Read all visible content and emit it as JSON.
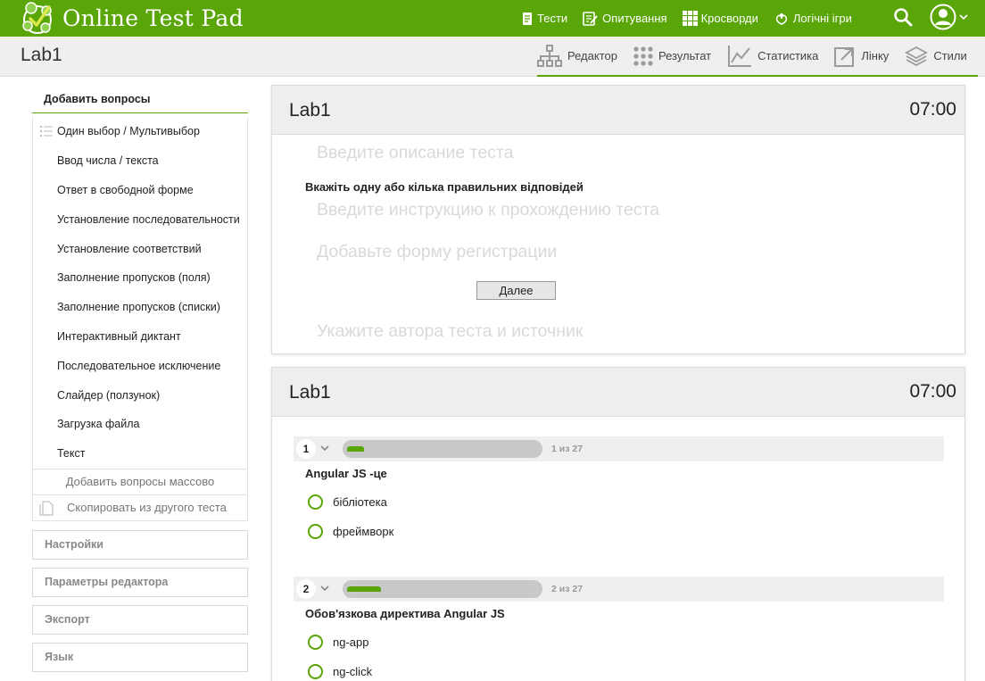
{
  "brand": {
    "name": "Online Test Pad",
    "accent": "#5aa507"
  },
  "topnav": [
    {
      "label": "Тести",
      "icon": "document-icon"
    },
    {
      "label": "Опитування",
      "icon": "survey-icon"
    },
    {
      "label": "Кросворди",
      "icon": "grid-icon"
    },
    {
      "label": "Логічні ігри",
      "icon": "puzzle-icon"
    }
  ],
  "page_title": "Lab1",
  "subnav": [
    {
      "label": "Редактор",
      "icon": "tree-icon"
    },
    {
      "label": "Результат",
      "icon": "dots-grid-icon"
    },
    {
      "label": "Статистика",
      "icon": "chart-icon"
    },
    {
      "label": "Лінку",
      "icon": "link-icon"
    },
    {
      "label": "Стили",
      "icon": "layers-icon"
    }
  ],
  "sidebar": {
    "heading": "Добавить вопросы",
    "items": [
      "Один выбор / Мультивыбор",
      "Ввод числа / текста",
      "Ответ в свободной форме",
      "Установление последовательности",
      "Установление соответствий",
      "Заполнение пропусков (поля)",
      "Заполнение пропусков (списки)",
      "Интерактивный диктант",
      "Последовательное исключение",
      "Слайдер (ползунок)",
      "Загрузка файла",
      "Текст"
    ],
    "bulk_add": "Добавить вопросы массово",
    "copy_from": "Скопировать из другого теста",
    "sections": [
      "Настройки",
      "Параметры редактора",
      "Экспорт",
      "Язык"
    ]
  },
  "panel1": {
    "title": "Lab1",
    "timer": "07:00",
    "description_placeholder": "Введите описание теста",
    "instruction": "Вкажіть одну або кілька правильних відповідей",
    "instruction_placeholder": "Введите инструкцию к прохождению теста",
    "registration_placeholder": "Добавьте форму регистрации",
    "next_button": "Далее",
    "author_placeholder": "Укажите автора теста и источник"
  },
  "panel2": {
    "title": "Lab1",
    "timer": "07:00",
    "questions": [
      {
        "number": "1",
        "counter": "1 из 27",
        "progress": 0.037,
        "text": "Angular JS -це",
        "options": [
          "бібліотека",
          "фреймворк"
        ]
      },
      {
        "number": "2",
        "counter": "2 из 27",
        "progress": 0.074,
        "text": "Обов'язкова директива Angular JS",
        "options": [
          "ng-app",
          "ng-click"
        ]
      }
    ]
  }
}
